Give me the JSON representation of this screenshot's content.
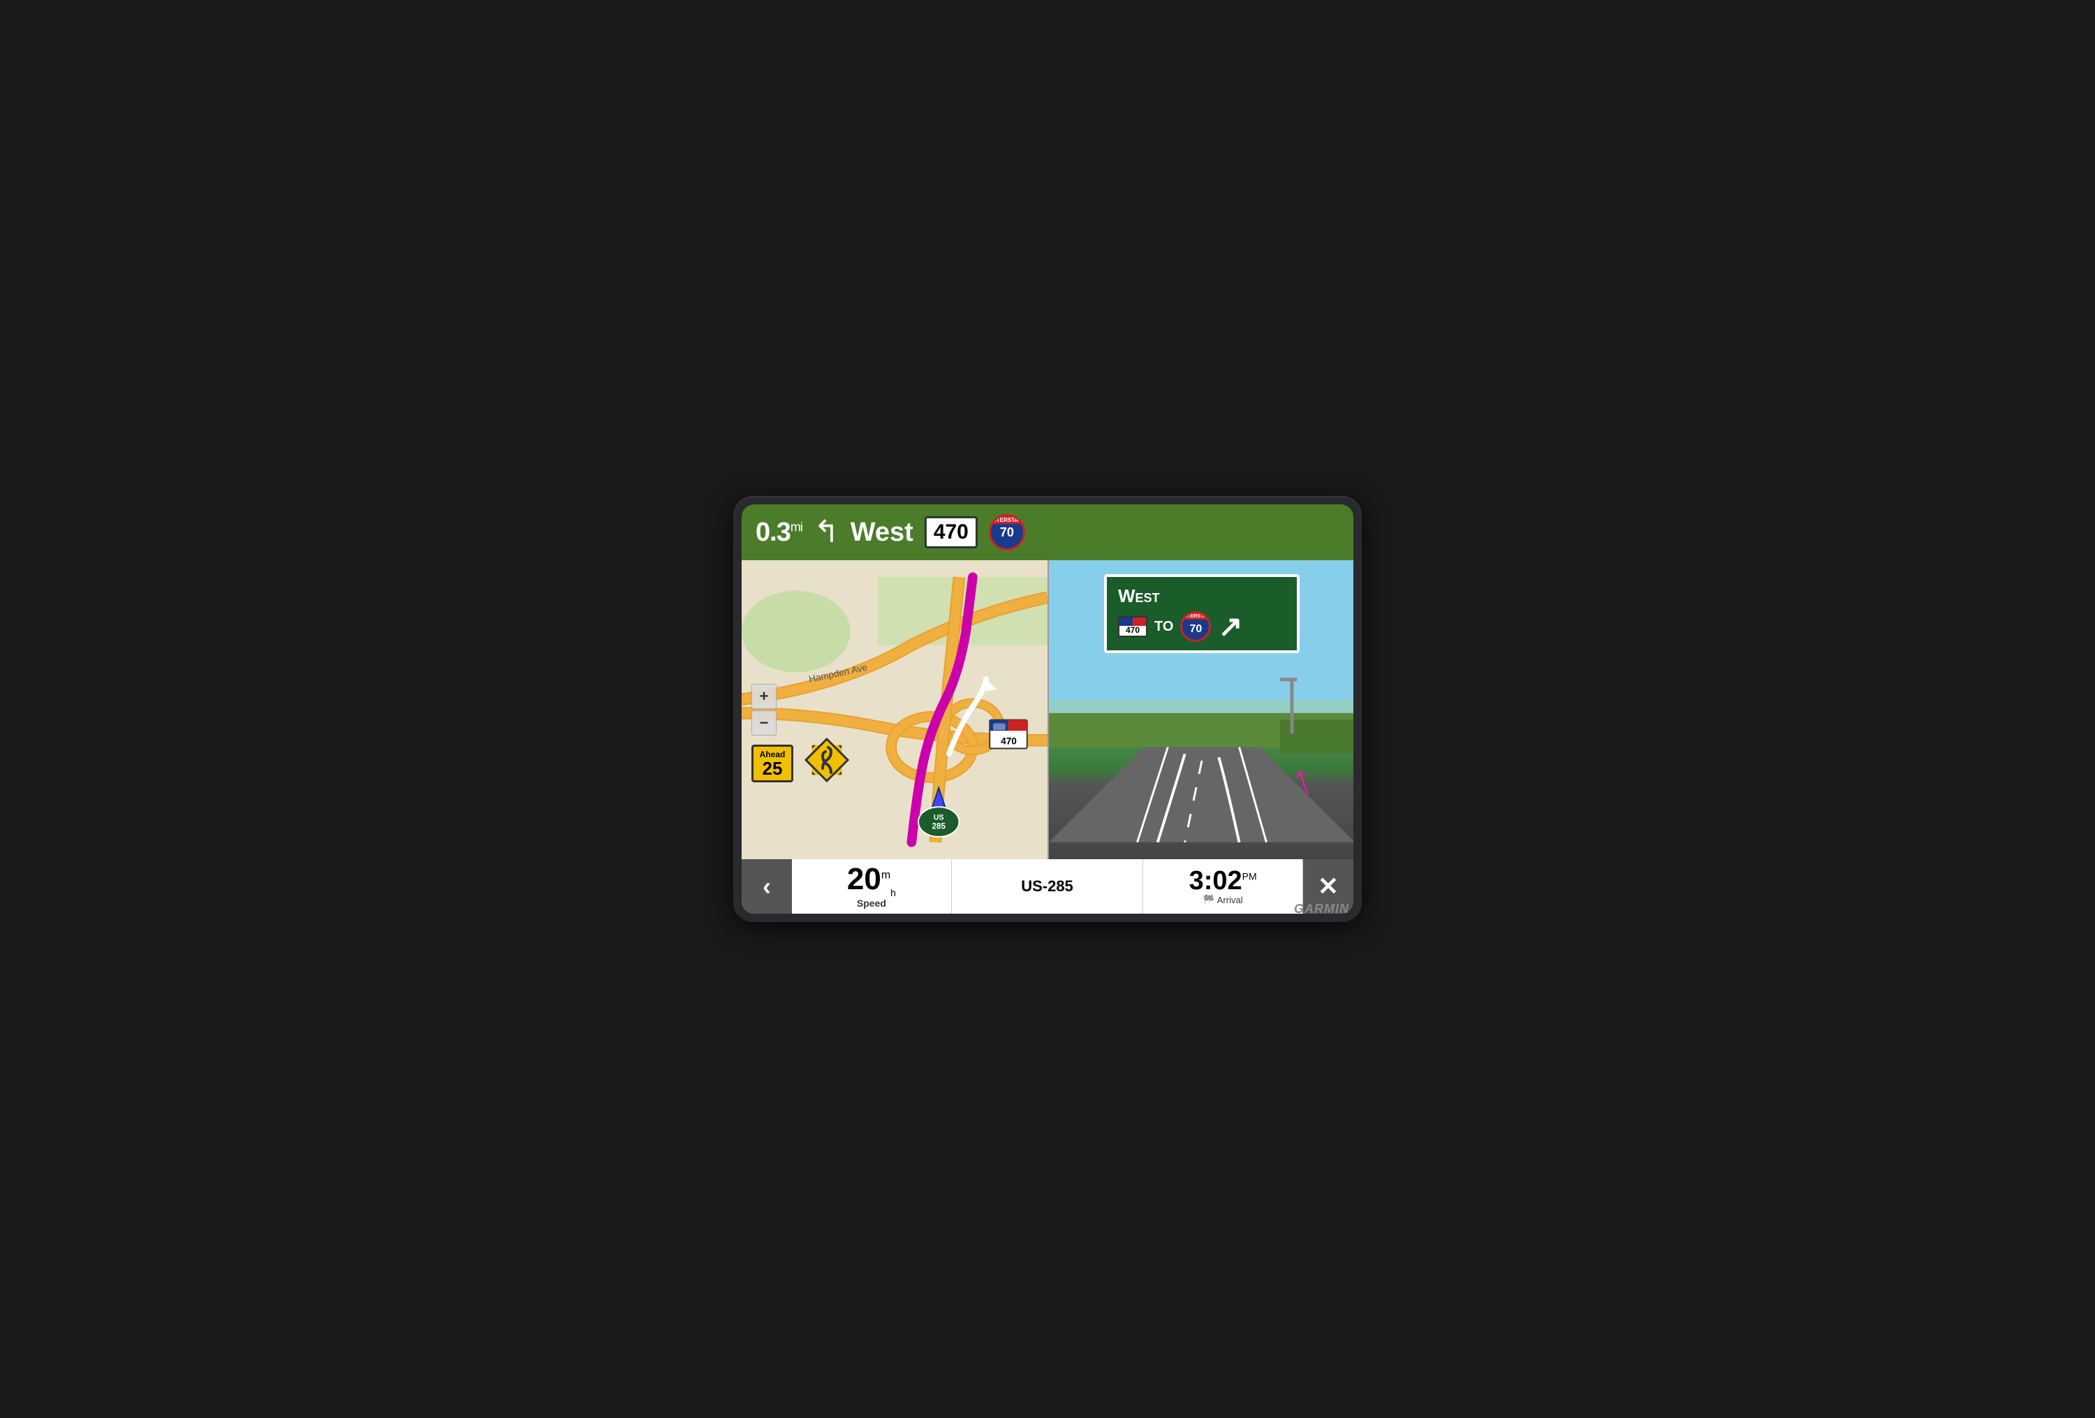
{
  "device": {
    "brand": "GARMIN"
  },
  "nav_bar": {
    "distance": "0.3",
    "distance_unit": "mi",
    "direction": "West",
    "route_number": "470",
    "interstate_number": "70",
    "interstate_label": "INTERSTATE"
  },
  "map": {
    "road_label": "Hampden Ave",
    "route_285": "285",
    "route_470": "470"
  },
  "ahead_sign": {
    "label": "Ahead",
    "number": "25"
  },
  "highway_sign": {
    "direction": "West",
    "route_co": "470",
    "to_text": "TO",
    "interstate": "70"
  },
  "bottom_bar": {
    "back_btn": "‹",
    "close_btn": "✕",
    "speed_value": "20",
    "speed_unit_top": "m",
    "speed_unit_bottom": "h",
    "speed_label": "Speed",
    "road_name": "US-285",
    "arrival_time": "3:02",
    "arrival_ampm": "PM",
    "arrival_label": "Arrival",
    "zoom_plus": "+",
    "zoom_minus": "−"
  }
}
